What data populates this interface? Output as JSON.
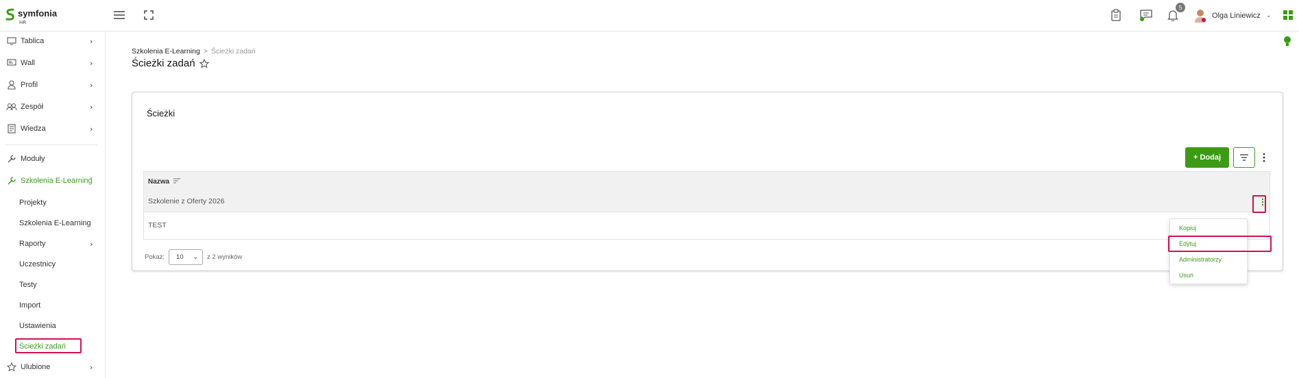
{
  "brand": {
    "name": "symfonia",
    "sub": "HR",
    "accent": "#3b9b14",
    "highlight": "#d0104c"
  },
  "topbar": {
    "notifications_count": "5",
    "user_name": "Olga Liniewicz"
  },
  "sidebar": {
    "items": [
      {
        "label": "Tablica",
        "icon": "dashboard-icon",
        "chevron": "›"
      },
      {
        "label": "Wall",
        "icon": "wall-icon",
        "chevron": "›"
      },
      {
        "label": "Profil",
        "icon": "profile-icon",
        "chevron": "›"
      },
      {
        "label": "Zespół",
        "icon": "team-icon",
        "chevron": "›"
      },
      {
        "label": "Wiedza",
        "icon": "knowledge-icon",
        "chevron": "›"
      },
      {
        "label": "Moduły",
        "icon": "wrench-icon"
      },
      {
        "label": "Szkolenia E-Learning",
        "icon": "wrench-icon",
        "chevron": "˅"
      }
    ],
    "subitems": [
      {
        "label": "Projekty"
      },
      {
        "label": "Szkolenia E-Learning"
      },
      {
        "label": "Raporty",
        "chevron": "›"
      },
      {
        "label": "Uczestnicy"
      },
      {
        "label": "Testy"
      },
      {
        "label": "Import"
      },
      {
        "label": "Ustawienia"
      },
      {
        "label": "Ścieżki zadań"
      }
    ],
    "favorites": {
      "label": "Ulubione",
      "icon": "star-icon",
      "chevron": "›"
    }
  },
  "breadcrumb": {
    "parent": "Szkolenia E-Learning",
    "sep": ">",
    "current": "Ścieżki zadań"
  },
  "page": {
    "title": "Ścieżki zadań"
  },
  "card": {
    "title": "Ścieżki",
    "add_label": "+ Dodaj",
    "table": {
      "header": "Nazwa",
      "rows": [
        "Szkolenie z Oferty 2026",
        "TEST"
      ]
    },
    "pager": {
      "show_label": "Pokaż:",
      "page_size": "10",
      "results_text": "z 2 wyników"
    }
  },
  "row_menu": {
    "items": [
      "Kopiuj",
      "Edytuj",
      "Administratorzy",
      "Usuń"
    ]
  }
}
